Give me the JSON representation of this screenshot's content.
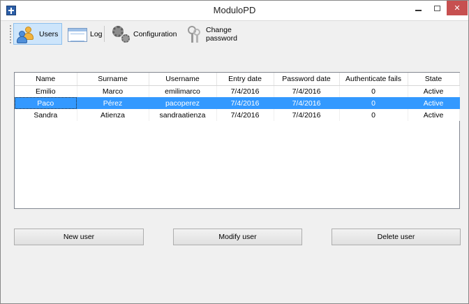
{
  "window": {
    "title": "ModuloPD"
  },
  "toolbar": {
    "users_label": "Users",
    "log_label": "Log",
    "configuration_label": "Configuration",
    "change_password_label": "Change password"
  },
  "table": {
    "headers": [
      "Name",
      "Surname",
      "Username",
      "Entry date",
      "Password date",
      "Authenticate fails",
      "State"
    ],
    "rows": [
      [
        "Emilio",
        "Marco",
        "emilimarco",
        "7/4/2016",
        "7/4/2016",
        "0",
        "Active"
      ],
      [
        "Paco",
        "Pérez",
        "pacoperez",
        "7/4/2016",
        "7/4/2016",
        "0",
        "Active"
      ],
      [
        "Sandra",
        "Atienza",
        "sandraatienza",
        "7/4/2016",
        "7/4/2016",
        "0",
        "Active"
      ]
    ],
    "selected_row": 1
  },
  "buttons": {
    "new_user": "New user",
    "modify_user": "Modify user",
    "delete_user": "Delete user"
  },
  "colors": {
    "selection": "#3399ff",
    "close_button": "#c75050",
    "active_tab": "#cde5fb"
  }
}
